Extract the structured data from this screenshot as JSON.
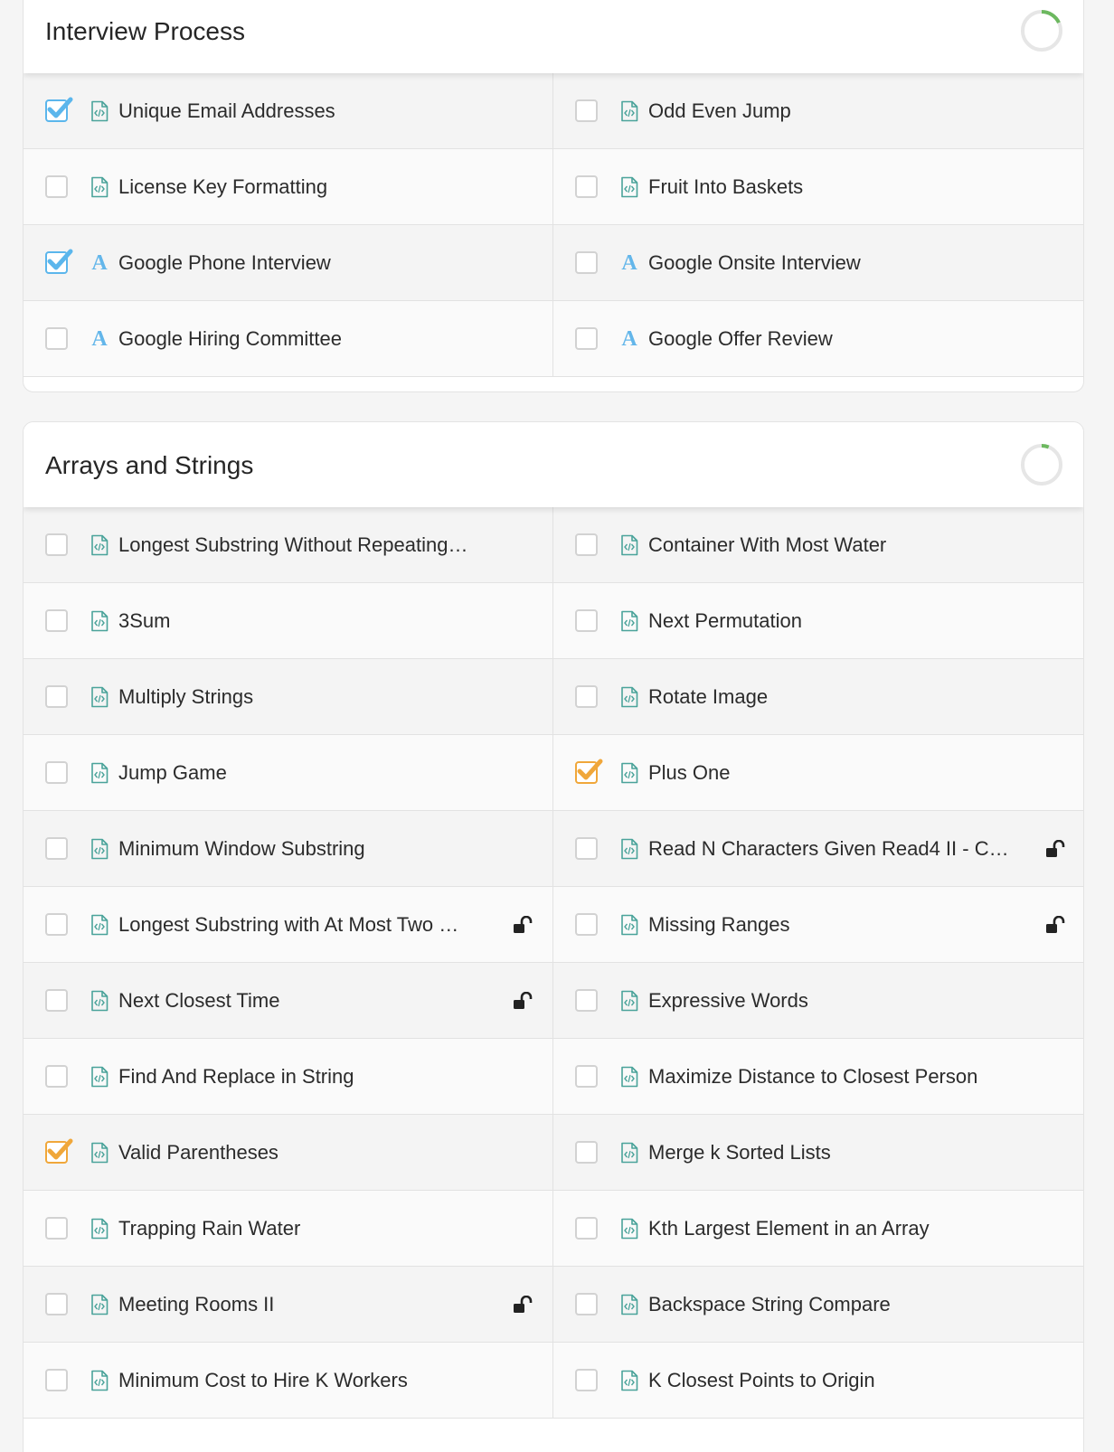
{
  "colors": {
    "check_blue": "#5bb6ec",
    "check_orange": "#f0a73a",
    "progress_green": "#6cb85f",
    "article_blue": "#63b6ea",
    "code_teal": "#4aa39a"
  },
  "sections": [
    {
      "title": "Interview Process",
      "progress": 0.18,
      "items": [
        {
          "label": "Unique Email Addresses",
          "type": "code",
          "status": "checked-blue",
          "locked": false
        },
        {
          "label": "Odd Even Jump",
          "type": "code",
          "status": "unchecked",
          "locked": false
        },
        {
          "label": "License Key Formatting",
          "type": "code",
          "status": "unchecked",
          "locked": false
        },
        {
          "label": "Fruit Into Baskets",
          "type": "code",
          "status": "unchecked",
          "locked": false
        },
        {
          "label": "Google Phone Interview",
          "type": "article",
          "status": "checked-blue",
          "locked": false
        },
        {
          "label": "Google Onsite Interview",
          "type": "article",
          "status": "unchecked",
          "locked": false
        },
        {
          "label": "Google Hiring Committee",
          "type": "article",
          "status": "unchecked",
          "locked": false
        },
        {
          "label": "Google Offer Review",
          "type": "article",
          "status": "unchecked",
          "locked": false
        }
      ]
    },
    {
      "title": "Arrays and Strings",
      "progress": 0.06,
      "items": [
        {
          "label": "Longest Substring Without Repeating…",
          "type": "code",
          "status": "unchecked",
          "locked": false
        },
        {
          "label": "Container With Most Water",
          "type": "code",
          "status": "unchecked",
          "locked": false
        },
        {
          "label": "3Sum",
          "type": "code",
          "status": "unchecked",
          "locked": false
        },
        {
          "label": "Next Permutation",
          "type": "code",
          "status": "unchecked",
          "locked": false
        },
        {
          "label": "Multiply Strings",
          "type": "code",
          "status": "unchecked",
          "locked": false
        },
        {
          "label": "Rotate Image",
          "type": "code",
          "status": "unchecked",
          "locked": false
        },
        {
          "label": "Jump Game",
          "type": "code",
          "status": "unchecked",
          "locked": false
        },
        {
          "label": "Plus One",
          "type": "code",
          "status": "checked-orange",
          "locked": false
        },
        {
          "label": "Minimum Window Substring",
          "type": "code",
          "status": "unchecked",
          "locked": false
        },
        {
          "label": "Read N Characters Given Read4 II - C…",
          "type": "code",
          "status": "unchecked",
          "locked": true
        },
        {
          "label": "Longest Substring with At Most Two …",
          "type": "code",
          "status": "unchecked",
          "locked": true
        },
        {
          "label": "Missing Ranges",
          "type": "code",
          "status": "unchecked",
          "locked": true
        },
        {
          "label": "Next Closest Time",
          "type": "code",
          "status": "unchecked",
          "locked": true
        },
        {
          "label": "Expressive Words",
          "type": "code",
          "status": "unchecked",
          "locked": false
        },
        {
          "label": "Find And Replace in String",
          "type": "code",
          "status": "unchecked",
          "locked": false
        },
        {
          "label": "Maximize Distance to Closest Person",
          "type": "code",
          "status": "unchecked",
          "locked": false
        },
        {
          "label": "Valid Parentheses",
          "type": "code",
          "status": "checked-orange",
          "locked": false
        },
        {
          "label": "Merge k Sorted Lists",
          "type": "code",
          "status": "unchecked",
          "locked": false
        },
        {
          "label": "Trapping Rain Water",
          "type": "code",
          "status": "unchecked",
          "locked": false
        },
        {
          "label": "Kth Largest Element in an Array",
          "type": "code",
          "status": "unchecked",
          "locked": false
        },
        {
          "label": "Meeting Rooms II",
          "type": "code",
          "status": "unchecked",
          "locked": true
        },
        {
          "label": "Backspace String Compare",
          "type": "code",
          "status": "unchecked",
          "locked": false
        },
        {
          "label": "Minimum Cost to Hire K Workers",
          "type": "code",
          "status": "unchecked",
          "locked": false
        },
        {
          "label": "K Closest Points to Origin",
          "type": "code",
          "status": "unchecked",
          "locked": false
        }
      ]
    }
  ],
  "icons": {
    "code": "code-file-icon",
    "article": "article-icon",
    "lock": "unlock-icon",
    "progress": "progress-ring-icon",
    "check": "checkmark-icon"
  }
}
